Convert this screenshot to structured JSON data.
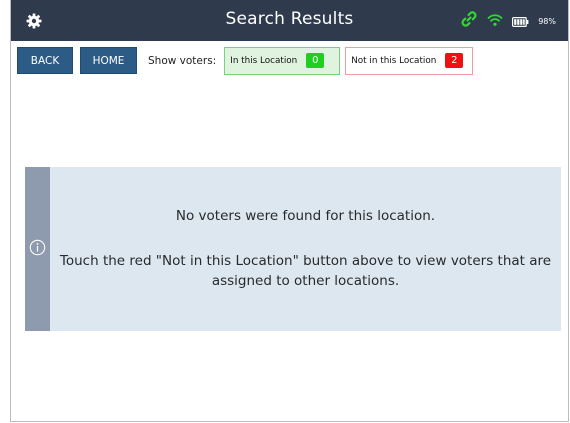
{
  "header": {
    "title": "Search Results",
    "battery_percent": "98%",
    "icons": [
      "gear-icon",
      "link-icon",
      "wifi-icon",
      "battery-icon"
    ],
    "background_color": "#2f3b4d"
  },
  "toolbar": {
    "back_label": "BACK",
    "home_label": "HOME",
    "show_voters_label": "Show voters:",
    "filters": [
      {
        "label": "In this Location",
        "count": "0",
        "color": "#1fcf1f"
      },
      {
        "label": "Not in this Location",
        "count": "2",
        "color": "#ee1111"
      }
    ],
    "button_color": "#2c5b86"
  },
  "message": {
    "line1": "No voters were found for this location.",
    "line2": "Touch the red \"Not in this Location\" button above to view voters that are assigned to other locations.",
    "icon": "info-icon",
    "background_color": "#dce7f0"
  }
}
